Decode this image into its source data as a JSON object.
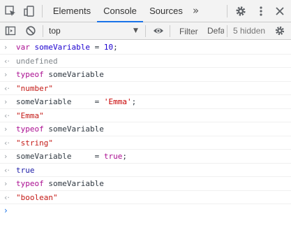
{
  "tabs": {
    "items": [
      {
        "label": "Elements"
      },
      {
        "label": "Console"
      },
      {
        "label": "Sources"
      }
    ],
    "more_label": "»",
    "active": "Console"
  },
  "toolbar": {
    "context": "top",
    "filter_placeholder": "Filter",
    "levels_label": "Default levels",
    "hidden_label": "5 hidden"
  },
  "console": {
    "rows": [
      {
        "kind": "input",
        "parts": [
          [
            "kw",
            "var"
          ],
          [
            "plain",
            " "
          ],
          [
            "var",
            "someVariable"
          ],
          [
            "plain",
            " = "
          ],
          [
            "num",
            "10"
          ],
          [
            "plain",
            ";"
          ]
        ]
      },
      {
        "kind": "output",
        "parts": [
          [
            "undef",
            "undefined"
          ]
        ]
      },
      {
        "kind": "input",
        "parts": [
          [
            "kw",
            "typeof"
          ],
          [
            "plain",
            " someVariable"
          ]
        ]
      },
      {
        "kind": "output",
        "parts": [
          [
            "outstr",
            "\"number\""
          ]
        ]
      },
      {
        "kind": "input",
        "parts": [
          [
            "plain",
            "someVariable     = "
          ],
          [
            "str",
            "'Emma'"
          ],
          [
            "plain",
            ";"
          ]
        ]
      },
      {
        "kind": "output",
        "parts": [
          [
            "outstr",
            "\"Emma\""
          ]
        ]
      },
      {
        "kind": "input",
        "parts": [
          [
            "kw",
            "typeof"
          ],
          [
            "plain",
            " someVariable"
          ]
        ]
      },
      {
        "kind": "output",
        "parts": [
          [
            "outstr",
            "\"string\""
          ]
        ]
      },
      {
        "kind": "input",
        "parts": [
          [
            "plain",
            "someVariable     = "
          ],
          [
            "kw",
            "true"
          ],
          [
            "plain",
            ";"
          ]
        ]
      },
      {
        "kind": "output",
        "parts": [
          [
            "outbool",
            "true"
          ]
        ]
      },
      {
        "kind": "input",
        "parts": [
          [
            "kw",
            "typeof"
          ],
          [
            "plain",
            " someVariable"
          ]
        ]
      },
      {
        "kind": "output",
        "parts": [
          [
            "outstr",
            "\"boolean\""
          ]
        ]
      }
    ],
    "input_prompt": "›",
    "output_prompt": "‹·",
    "caret_prompt": "›"
  },
  "colors": {
    "accent": "#1a73e8",
    "keyword": "#aa0d91",
    "string_output": "#c41a16",
    "string_input": "#c80000",
    "number": "#1c00cf"
  },
  "icons": {
    "inspect": "inspect-element-icon",
    "device": "device-toolbar-icon",
    "sidebar": "show-sidebar-icon",
    "clear": "clear-console-icon",
    "eye": "live-expression-icon",
    "gear": "gear-icon",
    "menu": "kebab-menu-icon",
    "close": "close-icon"
  }
}
